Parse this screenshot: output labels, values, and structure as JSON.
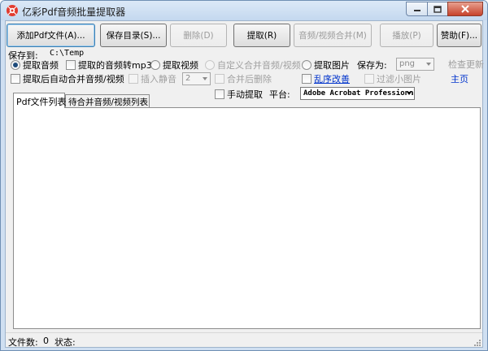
{
  "window": {
    "title": "亿彩Pdf音频批量提取器"
  },
  "toolbar": {
    "add_pdf": "添加Pdf文件(A)...",
    "save_dir": "保存目录(S)...",
    "delete": "删除(D)",
    "extract": "提取(R)",
    "merge": "音频/视频合并(M)",
    "play": "播放(P)",
    "sponsor": "赞助(F)..."
  },
  "options": {
    "save_to_label": "保存到:",
    "save_to_path": "C:\\Temp",
    "extract_audio": "提取音频",
    "convert_mp3": "提取的音频转mp3",
    "extract_video": "提取视频",
    "custom_merge": "自定义合并音频/视频",
    "extract_image": "提取图片",
    "save_as_label": "保存为:",
    "save_as_value": "png",
    "check_update": "检查更新",
    "auto_merge": "提取后自动合并音频/视频",
    "insert_silence": "插入静音",
    "silence_value": "2",
    "delete_after_merge": "合并后删除",
    "shuffle": "乱序改善",
    "filter_small": "过滤小图片",
    "homepage": "主页",
    "manual_extract": "手动提取",
    "platform_label": "平台:",
    "platform_value": "Adobe Acrobat Professional"
  },
  "tabs": [
    {
      "label": "Pdf文件列表",
      "active": true
    },
    {
      "label": "待合并音频/视频列表",
      "active": false
    }
  ],
  "status": {
    "file_count_label": "文件数:",
    "file_count": "0",
    "state_label": "状态:",
    "state": ""
  },
  "colors": {
    "link": "#0033cc",
    "frame": "#cfdff1",
    "close_button": "#c7432c"
  }
}
